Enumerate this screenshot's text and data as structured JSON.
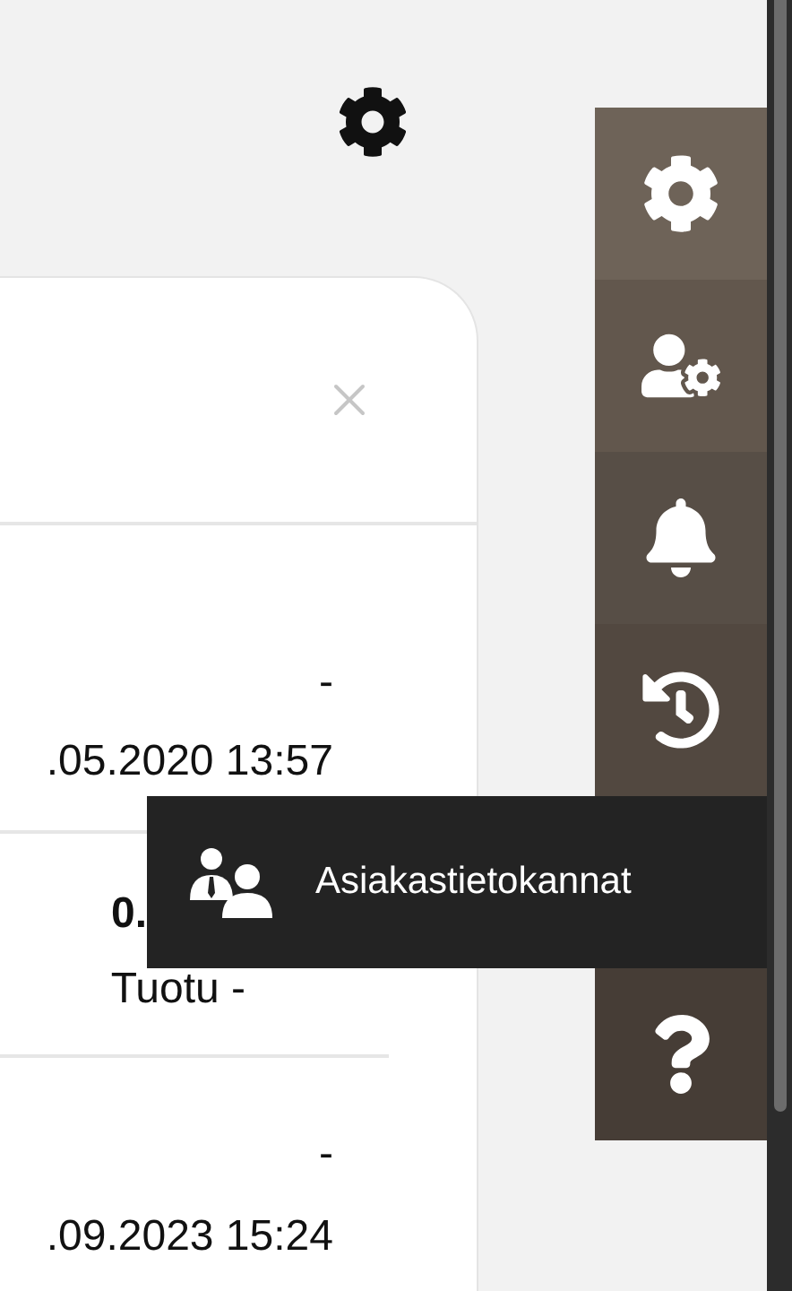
{
  "card": {
    "rows": [
      {
        "kind": "date",
        "lines": [
          "-",
          ".05.2020 13:57"
        ]
      },
      {
        "kind": "value",
        "lines": [
          "0.",
          "Tuotu -"
        ]
      },
      {
        "kind": "date",
        "lines": [
          "-",
          ".09.2023 15:24"
        ]
      }
    ]
  },
  "sidebar": {
    "items": [
      {
        "kind": "settings",
        "hovered": false
      },
      {
        "kind": "user-settings",
        "hovered": false
      },
      {
        "kind": "notifications",
        "hovered": false
      },
      {
        "kind": "history",
        "hovered": false
      },
      {
        "kind": "customers",
        "hovered": true,
        "label": "Asiakastietokannat"
      },
      {
        "kind": "help",
        "hovered": false
      }
    ]
  }
}
